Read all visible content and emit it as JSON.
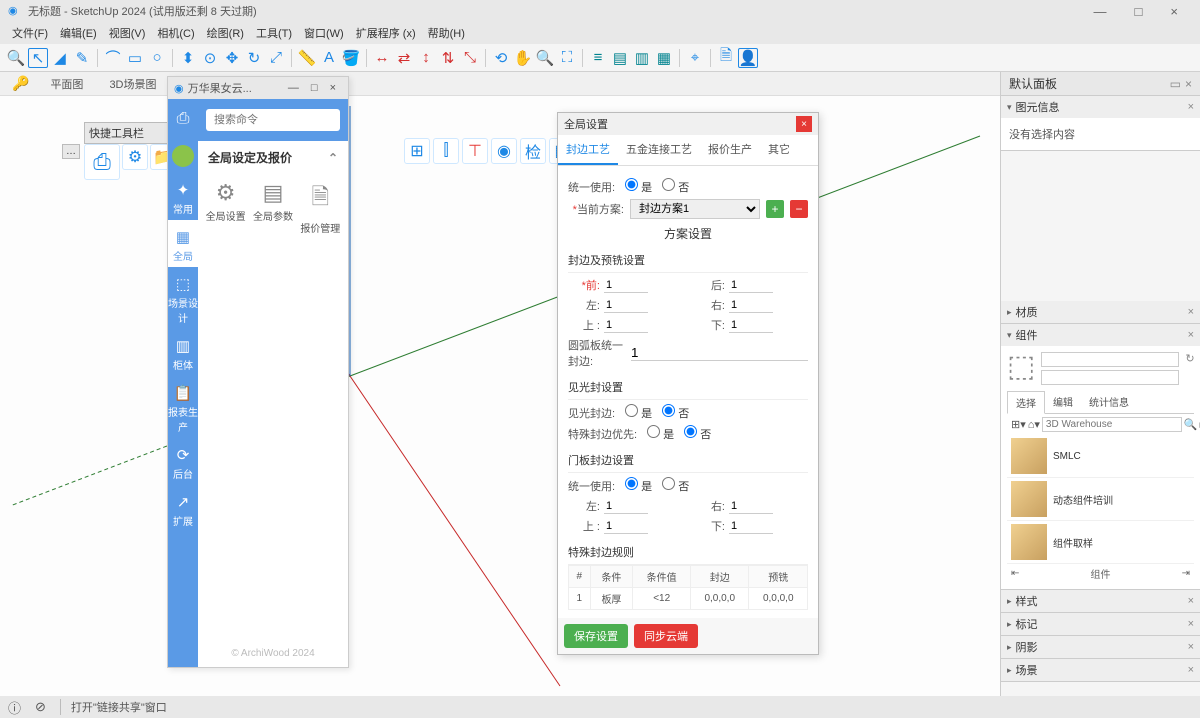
{
  "window": {
    "title": "无标题 - SketchUp 2024  (试用版还剩 8 天过期)",
    "min": "—",
    "max": "□",
    "close": "×"
  },
  "menu": [
    "文件(F)",
    "编辑(E)",
    "视图(V)",
    "相机(C)",
    "绘图(R)",
    "工具(T)",
    "窗口(W)",
    "扩展程序 (x)",
    "帮助(H)"
  ],
  "sceneTabs": [
    "平面图",
    "3D场景图"
  ],
  "quickPalette": {
    "dots": "…",
    "title": "快捷工具栏"
  },
  "ext": {
    "title": "万华果女云...",
    "searchPlaceholder": "搜索命令",
    "sideNav": [
      {
        "icon": "✦",
        "label": "常用"
      },
      {
        "icon": "▦",
        "label": "全局"
      },
      {
        "icon": "⬚",
        "label": "场景设计"
      },
      {
        "icon": "▥",
        "label": "柜体"
      },
      {
        "icon": "📋",
        "label": "报表生产"
      },
      {
        "icon": "⟳",
        "label": "后台"
      },
      {
        "icon": "↗",
        "label": "扩展"
      }
    ],
    "sectionTitle": "全局设定及报价",
    "shortcuts": [
      {
        "icon": "⚙",
        "label": "全局设置"
      },
      {
        "icon": "▤",
        "label": "全局参数"
      },
      {
        "icon": "🗎",
        "label": "报价管理"
      }
    ],
    "footer": "© ArchiWood 2024"
  },
  "dialog": {
    "title": "全局设置",
    "tabs": [
      "封边工艺",
      "五金连接工艺",
      "报价生产",
      "其它"
    ],
    "unifyLabel": "统一使用:",
    "yes": "是",
    "no": "否",
    "currentPlanLabel": "当前方案:",
    "currentPlan": "封边方案1",
    "planSettingsTitle": "方案设置",
    "group1": "封边及预铣设置",
    "front": "*前:",
    "back": "后:",
    "left": "左:",
    "right": "右:",
    "top": "上 :",
    "bottom": "下:",
    "v1": "1",
    "arcLabel": "圆弧板统一封边:",
    "group2": "见光封设置",
    "visibleEdge": "见光封边:",
    "specialPriority": "特殊封边优先:",
    "group3": "门板封边设置",
    "group4": "特殊封边规则",
    "tableHead": [
      "#",
      "条件",
      "条件值",
      "封边",
      "预铣"
    ],
    "tableRow": [
      "1",
      "板厚",
      "<12",
      "0,0,0,0",
      "0,0,0,0"
    ],
    "saveBtn": "保存设置",
    "syncBtn": "同步云端"
  },
  "right": {
    "panelTitle": "默认面板",
    "sections": {
      "entity": {
        "title": "图元信息",
        "body": "没有选择内容"
      },
      "material": "材质",
      "component": "组件",
      "style": "样式",
      "tag": "标记",
      "shadow": "阴影",
      "scene": "场景"
    },
    "compTabs": [
      "选择",
      "编辑",
      "统计信息"
    ],
    "compSearchPlaceholder": "3D Warehouse",
    "compItems": [
      {
        "name": "SMLC"
      },
      {
        "name": "动态组件培训"
      },
      {
        "name": "组件取样"
      }
    ],
    "navLabel": "组件"
  },
  "status": {
    "text": "打开\"链接共享\"窗口"
  }
}
